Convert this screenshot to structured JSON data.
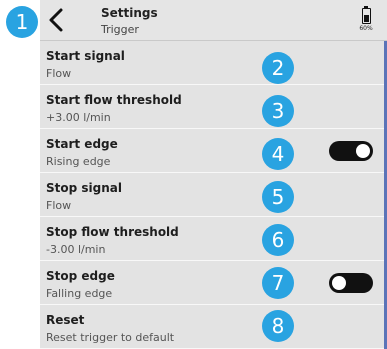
{
  "header": {
    "title": "Settings",
    "subtitle": "Trigger",
    "battery_percent": "60%",
    "battery_level": 0.6
  },
  "callouts": [
    "1",
    "2",
    "3",
    "4",
    "5",
    "6",
    "7",
    "8"
  ],
  "rows": [
    {
      "label": "Start signal",
      "value": "Flow"
    },
    {
      "label": "Start flow threshold",
      "value": "+3.00  l/min"
    },
    {
      "label": "Start edge",
      "value": "Rising edge",
      "toggle": "on"
    },
    {
      "label": "Stop signal",
      "value": "Flow"
    },
    {
      "label": "Stop flow threshold",
      "value": "-3.00  l/min"
    },
    {
      "label": "Stop edge",
      "value": "Falling edge",
      "toggle": "off"
    },
    {
      "label": "Reset",
      "value": "Reset trigger to default"
    }
  ],
  "icons": {
    "back": "chevron-left-icon",
    "battery": "battery-icon"
  },
  "colors": {
    "callout": "#29a3e1",
    "toggle": "#111111",
    "scrollbar": "#5b74b8"
  }
}
